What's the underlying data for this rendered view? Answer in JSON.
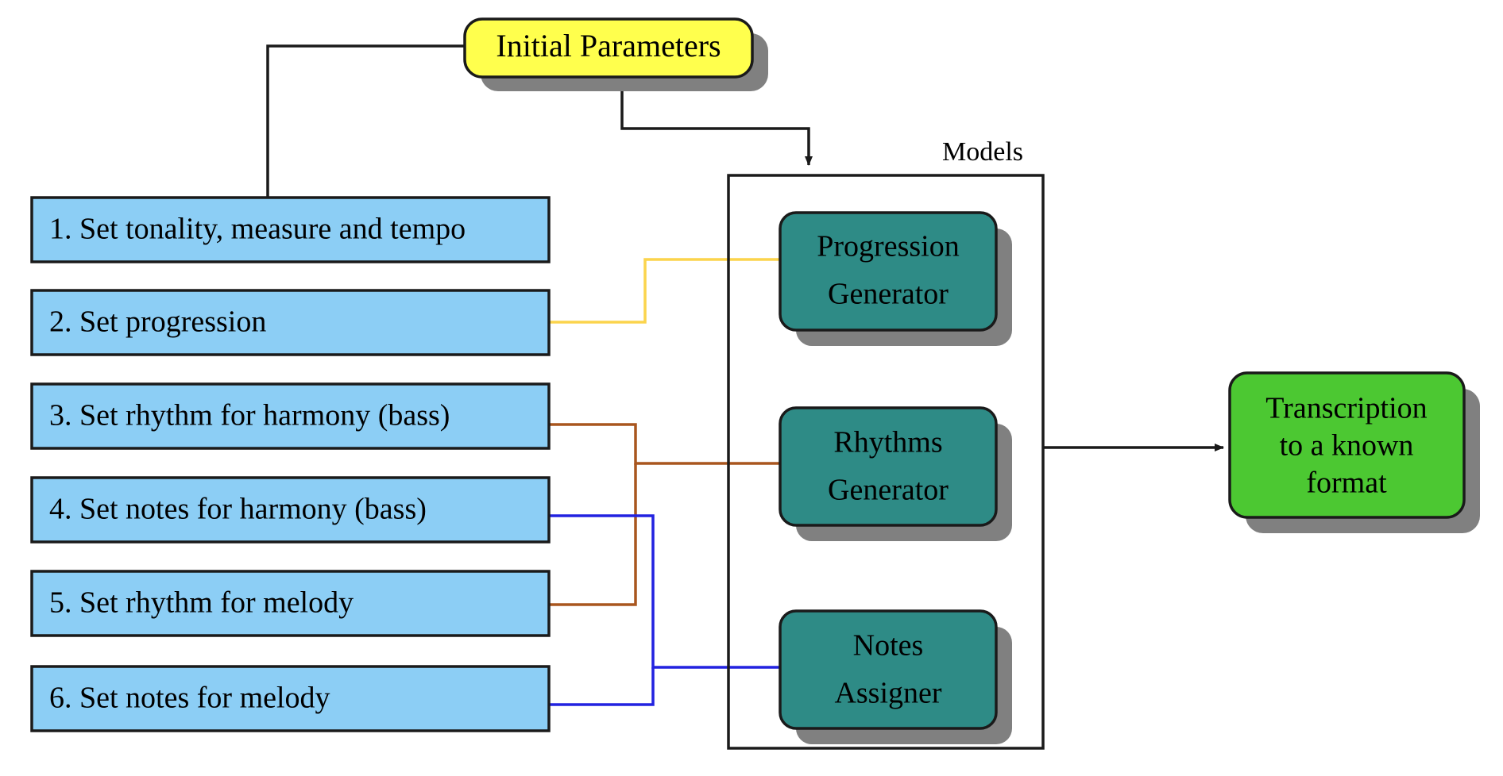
{
  "diagram": {
    "title_node": {
      "id": "initial-parameters",
      "label": "Initial Parameters",
      "fill": "#FFFF4D",
      "stroke": "#000000",
      "shadow": "#808080"
    },
    "steps": {
      "fill": "#8CCEF5",
      "stroke": "#000000",
      "items": [
        {
          "id": "step-1",
          "label": "1. Set tonality, measure and tempo"
        },
        {
          "id": "step-2",
          "label": "2. Set progression"
        },
        {
          "id": "step-3",
          "label": "3. Set rhythm for harmony (bass)"
        },
        {
          "id": "step-4",
          "label": "4. Set notes for harmony (bass)"
        },
        {
          "id": "step-5",
          "label": "5. Set rhythm for melody"
        },
        {
          "id": "step-6",
          "label": "6. Set notes for melody"
        }
      ]
    },
    "models_group": {
      "id": "models-container",
      "title": "Models",
      "stroke": "#000000",
      "node_fill": "#2E8B86",
      "node_shadow": "#808080",
      "nodes": [
        {
          "id": "progression-generator",
          "line1": "Progression",
          "line2": "Generator"
        },
        {
          "id": "rhythms-generator",
          "line1": "Rhythms",
          "line2": "Generator"
        },
        {
          "id": "notes-assigner",
          "line1": "Notes",
          "line2": "Assigner"
        }
      ]
    },
    "output_node": {
      "id": "transcription-output",
      "line1": "Transcription",
      "line2": "to a known",
      "line3": "format",
      "fill": "#4CC832",
      "stroke": "#000000",
      "shadow": "#808080"
    },
    "connectors": {
      "black": "#1a1a1a",
      "yellow": "#FBD44C",
      "brown": "#A9561E",
      "blue": "#2222E0"
    },
    "edges": [
      {
        "id": "edge-params-to-step1",
        "from": "initial-parameters",
        "to": "step-1",
        "color": "#1a1a1a",
        "arrow": false
      },
      {
        "id": "edge-params-to-models",
        "from": "initial-parameters",
        "to": "models-container",
        "color": "#1a1a1a",
        "arrow": true
      },
      {
        "id": "edge-step2-to-progression",
        "from": "step-2",
        "to": "progression-generator",
        "color": "#FBD44C",
        "arrow": false
      },
      {
        "id": "edge-step3-to-rhythms",
        "from": "step-3",
        "to": "rhythms-generator",
        "color": "#A9561E",
        "arrow": false
      },
      {
        "id": "edge-step5-to-rhythms",
        "from": "step-5",
        "to": "rhythms-generator",
        "color": "#A9561E",
        "arrow": false
      },
      {
        "id": "edge-step4-to-notes",
        "from": "step-4",
        "to": "notes-assigner",
        "color": "#2222E0",
        "arrow": false
      },
      {
        "id": "edge-step6-to-notes",
        "from": "step-6",
        "to": "notes-assigner",
        "color": "#2222E0",
        "arrow": false
      },
      {
        "id": "edge-models-to-transcription",
        "from": "models-container",
        "to": "transcription-output",
        "color": "#1a1a1a",
        "arrow": true
      }
    ]
  }
}
